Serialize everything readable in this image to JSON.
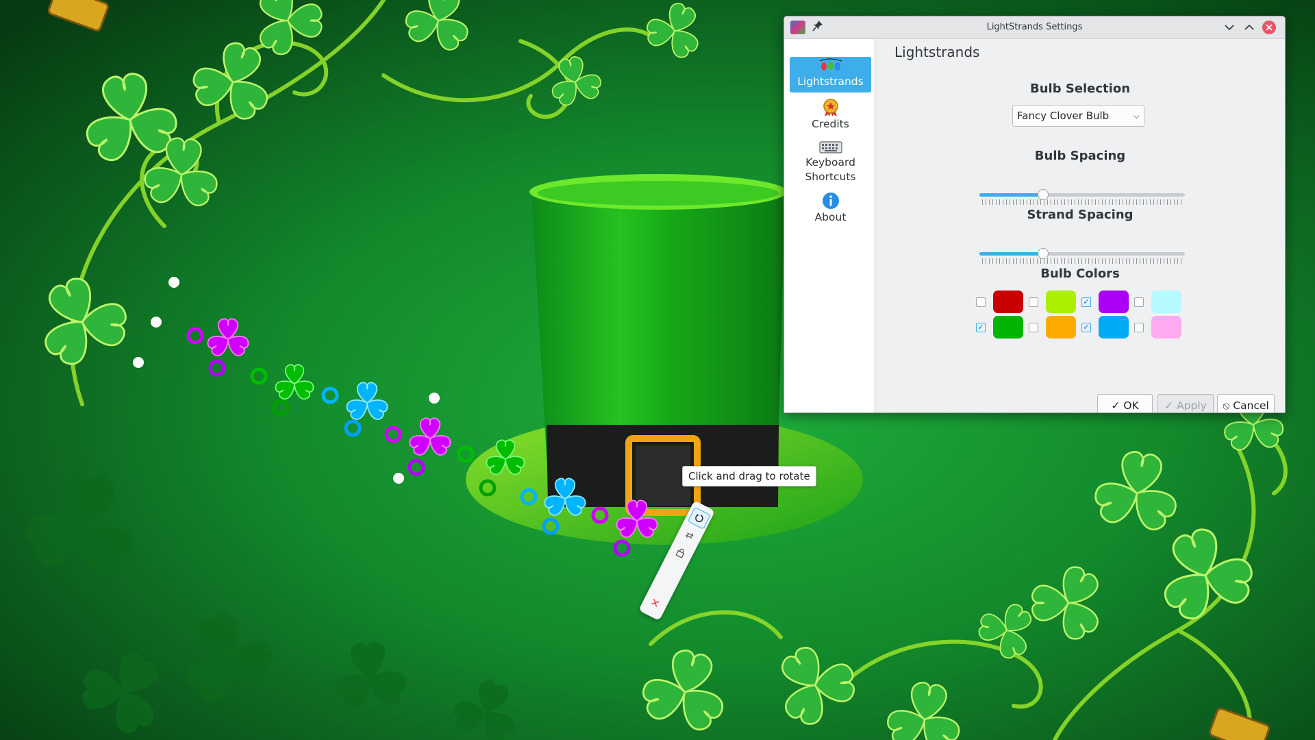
{
  "window": {
    "title": "LightStrands Settings",
    "app_icon": "lightstrands-app-icon",
    "pin_icon": "pin-icon",
    "controls": [
      "minimize",
      "maximize",
      "close"
    ]
  },
  "sidebar": {
    "items": [
      {
        "label": "Lightstrands",
        "icon": "lightbulbs-icon",
        "selected": true
      },
      {
        "label": "Credits",
        "icon": "award-medal-icon",
        "selected": false
      },
      {
        "label": "Keyboard Shortcuts",
        "icon": "keyboard-icon",
        "selected": false
      },
      {
        "label": "About",
        "icon": "info-icon",
        "selected": false
      }
    ]
  },
  "page": {
    "title": "Lightstrands",
    "bulb_selection": {
      "heading": "Bulb Selection",
      "value": "Fancy Clover Bulb"
    },
    "bulb_spacing": {
      "heading": "Bulb Spacing",
      "fraction": 0.31
    },
    "strand_spacing": {
      "heading": "Strand Spacing",
      "fraction": 0.31
    },
    "bulb_colors": {
      "heading": "Bulb Colors",
      "colors": [
        {
          "color": "#c80000",
          "checked": false
        },
        {
          "color": "#aaf000",
          "checked": false
        },
        {
          "color": "#aa00f5",
          "checked": true
        },
        {
          "color": "#b4faff",
          "checked": false
        },
        {
          "color": "#00b400",
          "checked": true
        },
        {
          "color": "#ffaa00",
          "checked": false
        },
        {
          "color": "#00aaf5",
          "checked": true
        },
        {
          "color": "#ffaaf0",
          "checked": false
        }
      ]
    }
  },
  "buttons": {
    "ok": "OK",
    "apply": "Apply",
    "cancel": "Cancel"
  },
  "desktop": {
    "tooltip": "Click and drag to rotate",
    "applet_handle_icons": [
      "rotate-icon",
      "configure-icon",
      "lock-icon",
      "remove-icon"
    ]
  },
  "colors": {
    "accent": "#3daee9",
    "close": "#e95469"
  }
}
